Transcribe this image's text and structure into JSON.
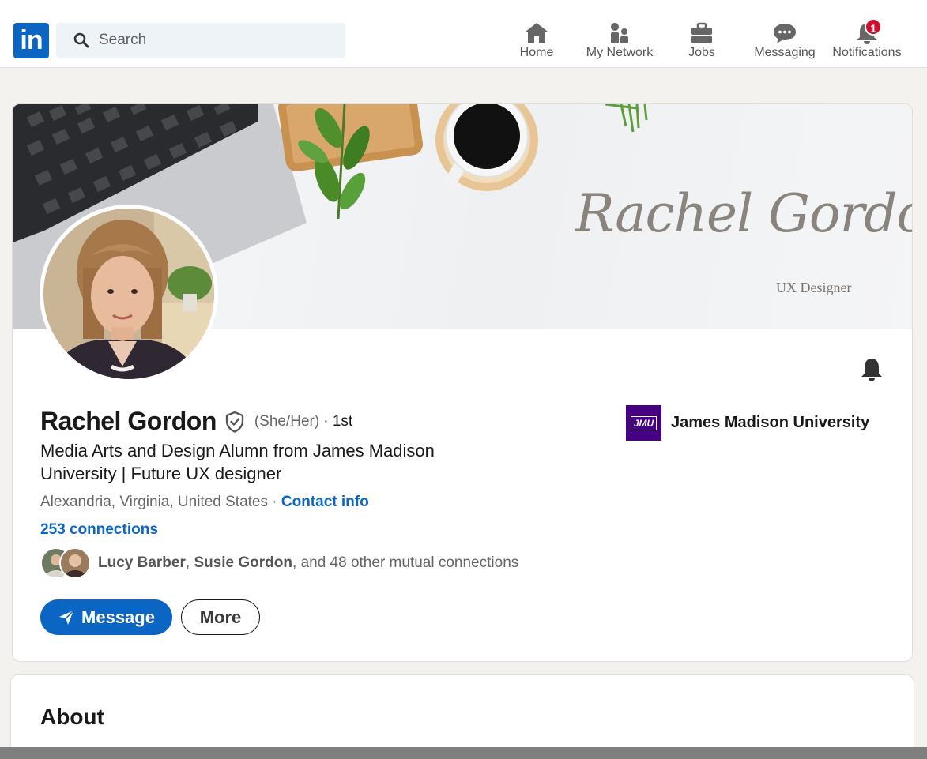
{
  "nav": {
    "logo_text": "in",
    "search_placeholder": "Search",
    "items": [
      {
        "label": "Home",
        "icon": "home-icon"
      },
      {
        "label": "My Network",
        "icon": "network-icon"
      },
      {
        "label": "Jobs",
        "icon": "briefcase-icon"
      },
      {
        "label": "Messaging",
        "icon": "chat-icon"
      },
      {
        "label": "Notifications",
        "icon": "bell-icon",
        "badge": "1"
      }
    ]
  },
  "profile": {
    "banner_script": "Rachel Gordon",
    "banner_subtitle": "UX Designer",
    "name": "Rachel Gordon",
    "pronouns": "(She/Her)",
    "degree": "· 1st",
    "headline": "Media Arts and Design Alumn from James Madison University | Future UX designer",
    "location": "Alexandria, Virginia, United States",
    "location_separator": " · ",
    "contact_info": "Contact info",
    "connections": "253 connections",
    "mutual": {
      "name1": "Lucy Barber",
      "sep": ", ",
      "name2": "Susie Gordon",
      "rest": ", and 48 other mutual connections"
    },
    "message_button": "Message",
    "more_button": "More",
    "education": {
      "logo_text": "JMU",
      "name": "James Madison University"
    }
  },
  "about": {
    "title": "About"
  },
  "colors": {
    "brand": "#0a66c2",
    "badge": "#cb112d",
    "jmu_purple": "#450084",
    "page_bg": "#f3f2ef"
  }
}
